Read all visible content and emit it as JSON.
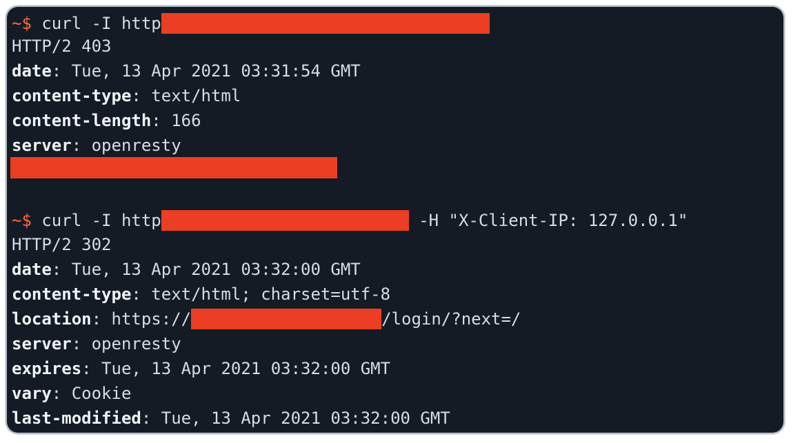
{
  "terminal": {
    "colors": {
      "background": "#141b24",
      "text": "#d7dde6",
      "prompt": "#ff6a3d",
      "redaction": "#ec3e24"
    },
    "block1": {
      "prompt": "~$",
      "command_prefix": " curl -I http",
      "response": [
        {
          "key": "",
          "value": "HTTP/2 403"
        },
        {
          "key": "date",
          "value": ": Tue, 13 Apr 2021 03:31:54 GMT"
        },
        {
          "key": "content-type",
          "value": ": text/html"
        },
        {
          "key": "content-length",
          "value": ": 166"
        },
        {
          "key": "server",
          "value": ": openresty"
        }
      ]
    },
    "block2": {
      "prompt": "~$",
      "command_prefix": " curl -I http",
      "command_suffix": " -H \"X-Client-IP: 127.0.0.1\"",
      "status": "HTTP/2 302",
      "date_key": "date",
      "date_value": ": Tue, 13 Apr 2021 03:32:00 GMT",
      "ctype_key": "content-type",
      "ctype_value": ": text/html; charset=utf-8",
      "location_key": "location",
      "location_prefix": ": https://",
      "location_suffix": "/login/?next=/",
      "server_key": "server",
      "server_value": ": openresty",
      "expires_key": "expires",
      "expires_value": ": Tue, 13 Apr 2021 03:32:00 GMT",
      "vary_key": "vary",
      "vary_value": ": Cookie",
      "lastmod_key": "last-modified",
      "lastmod_value": ": Tue, 13 Apr 2021 03:32:00 GMT"
    }
  }
}
